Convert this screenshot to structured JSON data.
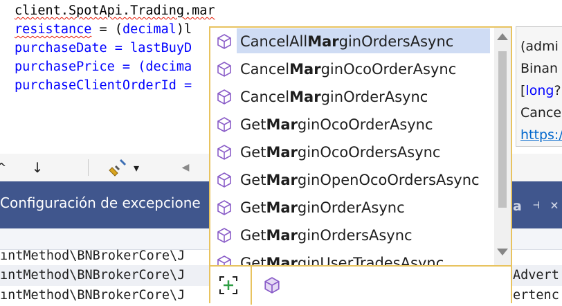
{
  "editor": {
    "lines": [
      {
        "a": "client.SpotApi.Trading.mar",
        "b": "",
        "c": ""
      },
      {
        "a": "resistance",
        "b": " = (",
        "c": "decimal",
        "d": ")l"
      },
      {
        "a": "purchaseDate = lastBuyD",
        "b": "",
        "c": ""
      },
      {
        "a": "purchasePrice = (",
        "c": "decima"
      },
      {
        "a": "purchaseClientOrderId =",
        "b": "",
        "c": ""
      }
    ]
  },
  "completion": {
    "items": [
      {
        "pre": "CancelAll",
        "match": "Mar",
        "post": "ginOrdersAsync",
        "selected": true
      },
      {
        "pre": "Cancel",
        "match": "Mar",
        "post": "ginOcoOrderAsync",
        "selected": false
      },
      {
        "pre": "Cancel",
        "match": "Mar",
        "post": "ginOrderAsync",
        "selected": false
      },
      {
        "pre": "Get",
        "match": "Mar",
        "post": "ginOcoOrderAsync",
        "selected": false
      },
      {
        "pre": "Get",
        "match": "Mar",
        "post": "ginOcoOrdersAsync",
        "selected": false
      },
      {
        "pre": "Get",
        "match": "Mar",
        "post": "ginOpenOcoOrdersAsync",
        "selected": false
      },
      {
        "pre": "Get",
        "match": "Mar",
        "post": "ginOrderAsync",
        "selected": false
      },
      {
        "pre": "Get",
        "match": "Mar",
        "post": "ginOrdersAsync",
        "selected": false
      },
      {
        "pre": "Get",
        "match": "Mar",
        "post": "ginUserTradesAsync",
        "selected": false
      }
    ],
    "icons": {
      "item": "method-cube-icon",
      "footer_filter": "add-filter-icon",
      "footer_method": "method-cube-icon"
    },
    "colors": {
      "border": "#e8c35f",
      "selected": "#cfdcf4",
      "cube": "#8a5dc8"
    }
  },
  "tooltip": {
    "line1": "(admi",
    "line2": "Binan",
    "line3_bracket": "[",
    "line3_kw": "long",
    "line3_end": "?",
    "line4": "Cance",
    "line5": "https:/"
  },
  "toolbar": {
    "down_arrow": "↓",
    "left_arrow": "◀",
    "dropdown_arrow": "▾"
  },
  "panel": {
    "title": "Configuración de excepcione",
    "right_label": "a",
    "pin": "⊣",
    "close": "×",
    "rows": [
      {
        "left": "ıntMethod\\BNBrokerCore\\J",
        "right": ""
      },
      {
        "left": "ıntMethod\\BNBrokerCore\\J",
        "right": "Advert"
      },
      {
        "left": "ıntMethod\\BNBrokerCore\\J",
        "right": "ertenc"
      }
    ]
  }
}
